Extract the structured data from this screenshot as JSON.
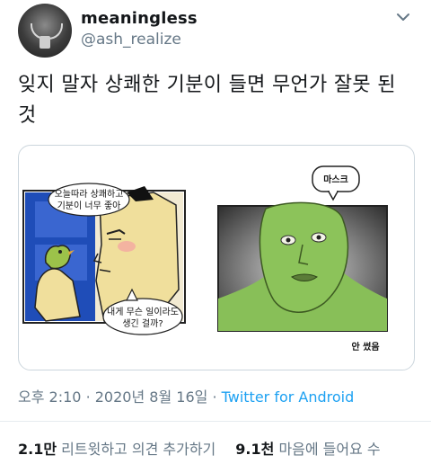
{
  "user": {
    "display_name": "meaningless",
    "handle": "@ash_realize"
  },
  "tweet": {
    "text": "잊지 말자 상쾌한 기분이 들면 무언가 잘못 된 것"
  },
  "media": {
    "panel1": {
      "bubble_top_line1": "오늘따라 상쾌하고",
      "bubble_top_line2": "기분이 너무 좋아",
      "bubble_bottom_line1": "내게 무슨 일이라도",
      "bubble_bottom_line2": "생긴 걸까?"
    },
    "panel2": {
      "bubble": "마스크",
      "caption": "안 썼음"
    }
  },
  "meta": {
    "time": "오후 2:10",
    "separator": "·",
    "date": "2020년 8월 16일",
    "via": "Twitter for Android"
  },
  "stats": {
    "retweets_count": "2.1만",
    "retweets_label": "리트윗하고 의견 추가하기",
    "likes_count": "9.1천",
    "likes_label": "마음에 들어요 수"
  },
  "icons": {
    "caret": "chevron-down-icon",
    "avatar": "avatar"
  },
  "colors": {
    "link": "#1da1f2",
    "secondary_text": "#657786",
    "border": "#ccd6dd",
    "green_face": "#8cc35a"
  }
}
